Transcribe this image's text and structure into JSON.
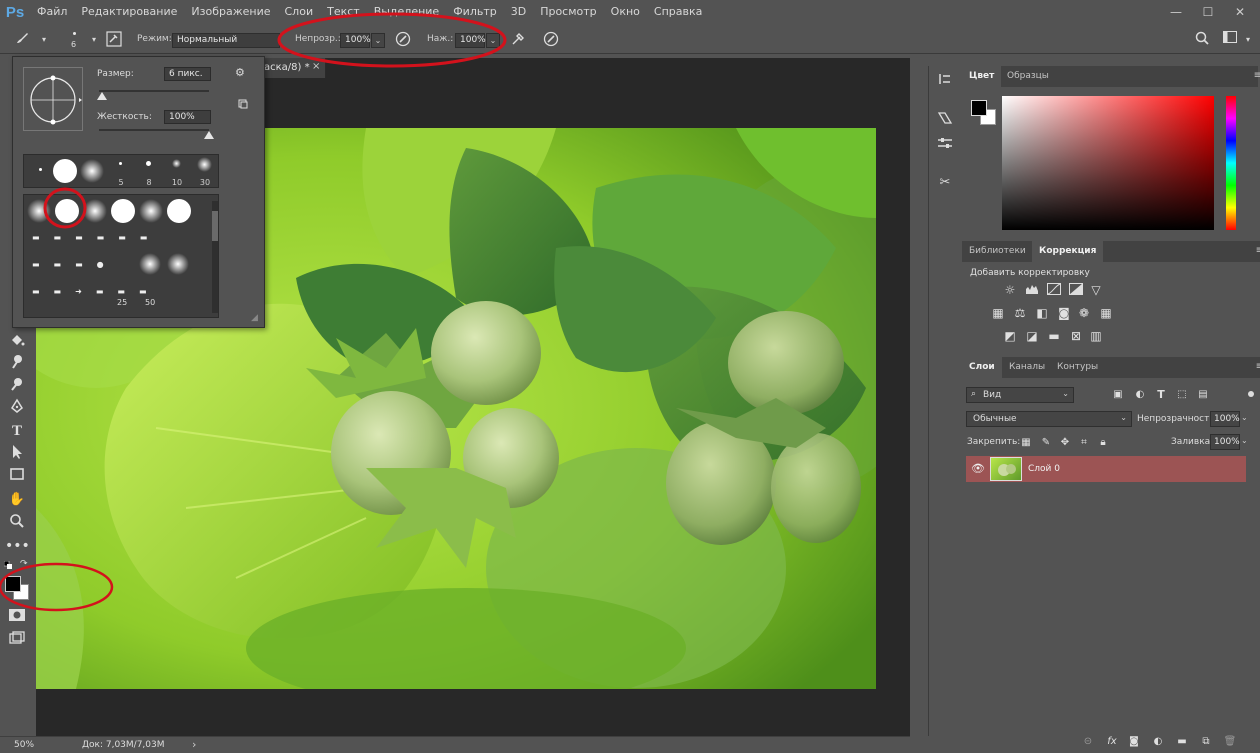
{
  "app": {
    "logo": "Ps"
  },
  "menu": [
    "Файл",
    "Редактирование",
    "Изображение",
    "Слои",
    "Текст",
    "Выделение",
    "Фильтр",
    "3D",
    "Просмотр",
    "Окно",
    "Справка"
  ],
  "window_buttons": {
    "minimize": "—",
    "maximize": "☐",
    "close": "✕"
  },
  "options": {
    "brush_size": "6",
    "mode_label": "Режим:",
    "mode_value": "Нормальный",
    "opacity_label": "Непрозр.:",
    "opacity_value": "100%",
    "pressure_label": "Наж.:",
    "pressure_value": "100%"
  },
  "document": {
    "tab_title": "аска/8) *",
    "close": "×"
  },
  "brush_popup": {
    "size_label": "Размер:",
    "size_value": "6 пикс.",
    "hardness_label": "Жесткость:",
    "hardness_value": "100%",
    "size_fraction": 0.03,
    "hardness_fraction": 1.0,
    "top_row_numbers": [
      "5",
      "8",
      "10",
      "30"
    ],
    "grid_numbers": [
      "25",
      "50"
    ]
  },
  "status": {
    "zoom": "50%",
    "doc_size": "Док: 7,03M/7,03M",
    "arrow": "›"
  },
  "color_panel": {
    "tabs": [
      "Цвет",
      "Образцы"
    ],
    "active": "Цвет"
  },
  "adjust_panel": {
    "tabs": [
      "Библиотеки",
      "Коррекция"
    ],
    "active": "Коррекция",
    "title": "Добавить корректировку"
  },
  "layers_panel": {
    "tabs": [
      "Слои",
      "Каналы",
      "Контуры"
    ],
    "active": "Слои",
    "filter_label": "Вид",
    "blend_mode": "Обычные",
    "opacity_label": "Непрозрачность:",
    "opacity_value": "100%",
    "lock_label": "Закрепить:",
    "fill_label": "Заливка:",
    "fill_value": "100%",
    "layers": [
      {
        "name": "Слой 0",
        "visible": true
      }
    ]
  },
  "colors": {
    "foreground": "#000000",
    "background": "#ffffff",
    "layer_selected": "#9c5454",
    "annotation": "#d3121c",
    "ps_blue": "#5da9e4"
  }
}
